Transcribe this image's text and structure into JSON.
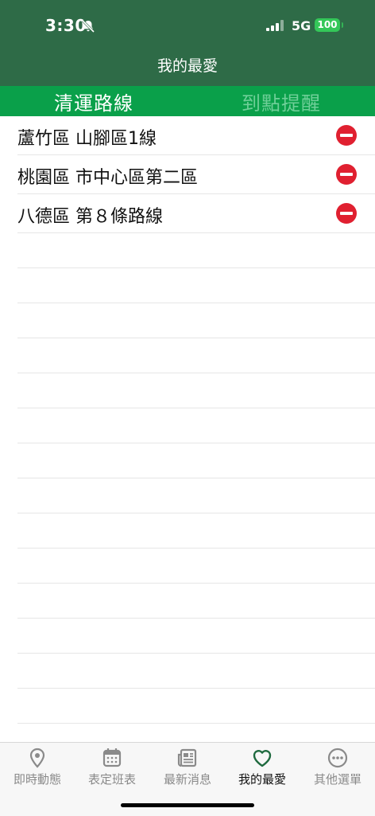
{
  "status": {
    "time": "3:30",
    "network": "5G",
    "battery": "100"
  },
  "header": {
    "title": "我的最愛"
  },
  "tabs": [
    {
      "label": "清運路線",
      "active": true
    },
    {
      "label": "到點提醒",
      "active": false
    }
  ],
  "favorites": [
    {
      "label": "蘆竹區 山腳區1線",
      "action_icon": "remove-icon"
    },
    {
      "label": "桃園區 市中心區第二區",
      "action_icon": "remove-icon"
    },
    {
      "label": "八德區 第８條路線",
      "action_icon": "remove-icon"
    }
  ],
  "tabbar": {
    "items": [
      {
        "label": "即時動態",
        "icon": "location-pin-icon",
        "active": false
      },
      {
        "label": "表定班表",
        "icon": "calendar-icon",
        "active": false
      },
      {
        "label": "最新消息",
        "icon": "newspaper-icon",
        "active": false
      },
      {
        "label": "我的最愛",
        "icon": "heart-icon",
        "active": true
      },
      {
        "label": "其他選單",
        "icon": "more-icon",
        "active": false
      }
    ]
  },
  "colors": {
    "header": "#2e6b47",
    "tab_bar": "#0aa04a",
    "remove": "#e02030",
    "active_nav": "#1f6a3f"
  }
}
